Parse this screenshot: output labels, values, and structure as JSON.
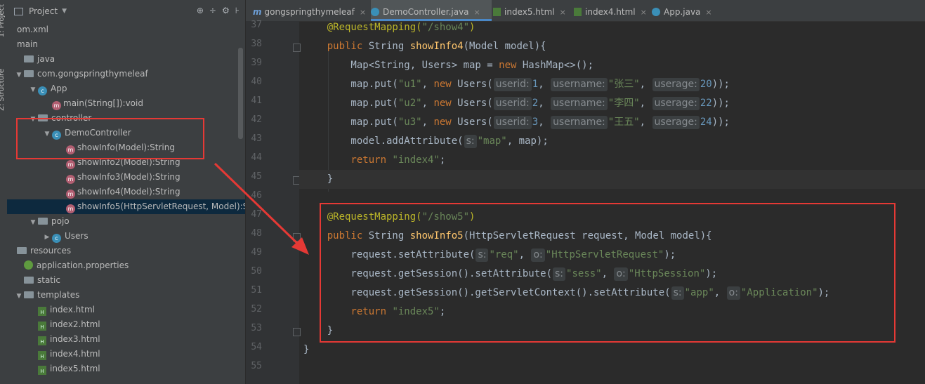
{
  "side_tabs": {
    "project": "1: Project",
    "structure": "Z: Structure"
  },
  "project": {
    "header": {
      "title": "Project",
      "toolbar_icons": [
        "⊕",
        "÷",
        "⚙",
        "⊦"
      ]
    },
    "tree": [
      {
        "label": "om.xml",
        "indent": 0,
        "arrow": "",
        "icon": "none"
      },
      {
        "label": "main",
        "indent": 0,
        "arrow": "",
        "icon": "none"
      },
      {
        "label": "java",
        "indent": 1,
        "arrow": "",
        "icon": "folder"
      },
      {
        "label": "com.gongspringthymeleaf",
        "indent": 1,
        "arrow": "▼",
        "icon": "folder"
      },
      {
        "label": "App",
        "indent": 2,
        "arrow": "▼",
        "icon": "class"
      },
      {
        "label": "main(String[]):void",
        "indent": 3,
        "arrow": "",
        "icon": "method"
      },
      {
        "label": "controller",
        "indent": 2,
        "arrow": "▼",
        "icon": "folder"
      },
      {
        "label": "DemoController",
        "indent": 3,
        "arrow": "▼",
        "icon": "class"
      },
      {
        "label": "showInfo(Model):String",
        "indent": 4,
        "arrow": "",
        "icon": "method"
      },
      {
        "label": "showInfo2(Model):String",
        "indent": 4,
        "arrow": "",
        "icon": "method"
      },
      {
        "label": "showInfo3(Model):String",
        "indent": 4,
        "arrow": "",
        "icon": "method"
      },
      {
        "label": "showInfo4(Model):String",
        "indent": 4,
        "arrow": "",
        "icon": "method"
      },
      {
        "label": "showInfo5(HttpServletRequest, Model):S",
        "indent": 4,
        "arrow": "",
        "icon": "method",
        "selected": true
      },
      {
        "label": "pojo",
        "indent": 2,
        "arrow": "▼",
        "icon": "folder"
      },
      {
        "label": "Users",
        "indent": 3,
        "arrow": "▶",
        "icon": "class"
      },
      {
        "label": "resources",
        "indent": 0,
        "arrow": "",
        "icon": "folder"
      },
      {
        "label": "application.properties",
        "indent": 1,
        "arrow": "",
        "icon": "leaf"
      },
      {
        "label": "static",
        "indent": 1,
        "arrow": "",
        "icon": "folder"
      },
      {
        "label": "templates",
        "indent": 1,
        "arrow": "▼",
        "icon": "folder"
      },
      {
        "label": "index.html",
        "indent": 2,
        "arrow": "",
        "icon": "html"
      },
      {
        "label": "index2.html",
        "indent": 2,
        "arrow": "",
        "icon": "html"
      },
      {
        "label": "index3.html",
        "indent": 2,
        "arrow": "",
        "icon": "html"
      },
      {
        "label": "index4.html",
        "indent": 2,
        "arrow": "",
        "icon": "html"
      },
      {
        "label": "index5.html",
        "indent": 2,
        "arrow": "",
        "icon": "html"
      }
    ]
  },
  "tabs": [
    {
      "label": "gongspringthymeleaf",
      "icon": "m",
      "active": false
    },
    {
      "label": "DemoController.java",
      "icon": "class",
      "active": true
    },
    {
      "label": "index5.html",
      "icon": "html",
      "active": false
    },
    {
      "label": "index4.html",
      "icon": "html",
      "active": false
    },
    {
      "label": "App.java",
      "icon": "app",
      "active": false
    }
  ],
  "tab_close": "×",
  "editor": {
    "line_numbers": [
      "37",
      "38",
      "39",
      "40",
      "41",
      "42",
      "43",
      "44",
      "45",
      "46",
      "47",
      "48",
      "49",
      "50",
      "51",
      "52",
      "53",
      "54",
      "55"
    ],
    "lines": [
      [
        [
          "an",
          "    @RequestMapping("
        ],
        [
          "st",
          "\"/show4\""
        ],
        [
          "an",
          ")"
        ]
      ],
      [
        [
          "kw",
          "    public "
        ],
        [
          "tx",
          "String "
        ],
        [
          "mn",
          "showInfo4"
        ],
        [
          "tx",
          "(Model model){"
        ]
      ],
      [
        [
          "tx",
          "        Map<String, Users> map = "
        ],
        [
          "kw",
          "new "
        ],
        [
          "tx",
          "HashMap<>();"
        ]
      ],
      [
        [
          "tx",
          "        map.put("
        ],
        [
          "st",
          "\"u1\""
        ],
        [
          "tx",
          ", "
        ],
        [
          "kw",
          "new "
        ],
        [
          "tx",
          "Users("
        ],
        [
          "hint",
          "userid:"
        ],
        [
          "nm",
          "1"
        ],
        [
          "tx",
          ", "
        ],
        [
          "hint",
          "username:"
        ],
        [
          "st",
          "\"张三\""
        ],
        [
          "tx",
          ", "
        ],
        [
          "hint",
          "userage:"
        ],
        [
          "nm",
          "20"
        ],
        [
          "tx",
          "));"
        ]
      ],
      [
        [
          "tx",
          "        map.put("
        ],
        [
          "st",
          "\"u2\""
        ],
        [
          "tx",
          ", "
        ],
        [
          "kw",
          "new "
        ],
        [
          "tx",
          "Users("
        ],
        [
          "hint",
          "userid:"
        ],
        [
          "nm",
          "2"
        ],
        [
          "tx",
          ", "
        ],
        [
          "hint",
          "username:"
        ],
        [
          "st",
          "\"李四\""
        ],
        [
          "tx",
          ", "
        ],
        [
          "hint",
          "userage:"
        ],
        [
          "nm",
          "22"
        ],
        [
          "tx",
          "));"
        ]
      ],
      [
        [
          "tx",
          "        map.put("
        ],
        [
          "st",
          "\"u3\""
        ],
        [
          "tx",
          ", "
        ],
        [
          "kw",
          "new "
        ],
        [
          "tx",
          "Users("
        ],
        [
          "hint",
          "userid:"
        ],
        [
          "nm",
          "3"
        ],
        [
          "tx",
          ", "
        ],
        [
          "hint",
          "username:"
        ],
        [
          "st",
          "\"王五\""
        ],
        [
          "tx",
          ", "
        ],
        [
          "hint",
          "userage:"
        ],
        [
          "nm",
          "24"
        ],
        [
          "tx",
          "));"
        ]
      ],
      [
        [
          "tx",
          "        model.addAttribute("
        ],
        [
          "hint",
          "s:"
        ],
        [
          "st",
          "\"map\""
        ],
        [
          "tx",
          ", map);"
        ]
      ],
      [
        [
          "kw",
          "        return "
        ],
        [
          "st",
          "\"index4\""
        ],
        [
          "tx",
          ";"
        ]
      ],
      [
        [
          "tx",
          "    }"
        ]
      ],
      [],
      [
        [
          "an",
          "    @RequestMapping("
        ],
        [
          "st",
          "\"/show5\""
        ],
        [
          "an",
          ")"
        ]
      ],
      [
        [
          "kw",
          "    public "
        ],
        [
          "tx",
          "String "
        ],
        [
          "mn",
          "showInfo5"
        ],
        [
          "tx",
          "(HttpServletRequest request, Model model){"
        ]
      ],
      [
        [
          "tx",
          "        request.setAttribute("
        ],
        [
          "hint",
          "s:"
        ],
        [
          "st",
          "\"req\""
        ],
        [
          "tx",
          ", "
        ],
        [
          "hint",
          "o:"
        ],
        [
          "st",
          "\"HttpServletRequest\""
        ],
        [
          "tx",
          ");"
        ]
      ],
      [
        [
          "tx",
          "        request.getSession().setAttribute("
        ],
        [
          "hint",
          "s:"
        ],
        [
          "st",
          "\"sess\""
        ],
        [
          "tx",
          ", "
        ],
        [
          "hint",
          "o:"
        ],
        [
          "st",
          "\"HttpSession\""
        ],
        [
          "tx",
          ");"
        ]
      ],
      [
        [
          "tx",
          "        request.getSession().getServletContext().setAttribute("
        ],
        [
          "hint",
          "s:"
        ],
        [
          "st",
          "\"app\""
        ],
        [
          "tx",
          ", "
        ],
        [
          "hint",
          "o:"
        ],
        [
          "st",
          "\"Application\""
        ],
        [
          "tx",
          ");"
        ]
      ],
      [
        [
          "kw",
          "        return "
        ],
        [
          "st",
          "\"index5\""
        ],
        [
          "tx",
          ";"
        ]
      ],
      [
        [
          "tx",
          "    }"
        ]
      ],
      [
        [
          "tx",
          "}"
        ]
      ],
      []
    ]
  },
  "colors": {
    "annotation_box": "#e53935",
    "accent_tab": "#4a88c7",
    "keyword": "#cc7832",
    "string": "#6a8759",
    "annotation": "#bbb529",
    "method": "#ffc66d",
    "number": "#6897bb"
  }
}
